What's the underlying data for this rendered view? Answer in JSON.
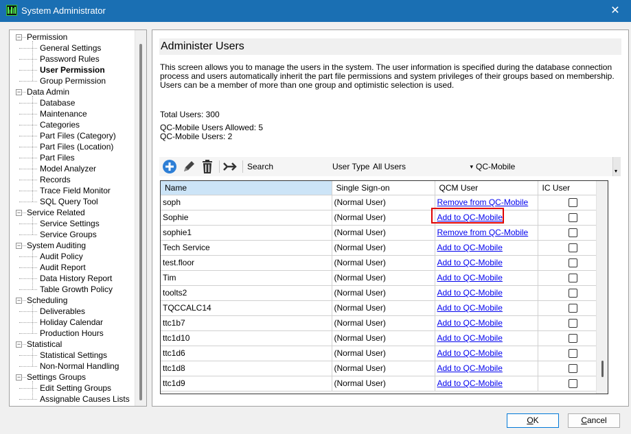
{
  "window": {
    "title": "System Administrator",
    "close_glyph": "✕"
  },
  "tree": {
    "groups": [
      {
        "label": "Permission",
        "children": [
          "General Settings",
          "Password Rules",
          "User Permission",
          "Group Permission"
        ]
      },
      {
        "label": "Data Admin",
        "children": [
          "Database",
          "Maintenance",
          "Categories",
          "Part Files (Category)",
          "Part Files (Location)",
          "Part Files",
          "Model Analyzer",
          "Records",
          "Trace Field Monitor",
          "SQL Query Tool"
        ]
      },
      {
        "label": "Service Related",
        "children": [
          "Service Settings",
          "Service Groups"
        ]
      },
      {
        "label": "System Auditing",
        "children": [
          "Audit Policy",
          "Audit Report",
          "Data History Report",
          "Table Growth Policy"
        ]
      },
      {
        "label": "Scheduling",
        "children": [
          "Deliverables",
          "Holiday Calendar",
          "Production Hours"
        ]
      },
      {
        "label": "Statistical",
        "children": [
          "Statistical Settings",
          "Non-Normal Handling"
        ]
      },
      {
        "label": "Settings Groups",
        "children": [
          "Edit Setting Groups",
          "Assignable Causes Lists"
        ]
      }
    ],
    "selected": "User Permission",
    "expander_glyph": "−"
  },
  "main": {
    "title": "Administer Users",
    "description": "This screen allows you to manage the users in the system. The user information is specified during the database connection process and users automatically inherit the part file permissions and system privileges of their groups based on membership. Users can be a member of more than one group and optimistic selection is used.",
    "total_users": "Total Users: 300",
    "qcm_allowed": "QC-Mobile Users Allowed: 5",
    "qcm_users": "QC-Mobile Users: 2"
  },
  "toolbar": {
    "icons": [
      "add-icon",
      "edit-icon",
      "delete-icon",
      "assign-icon"
    ],
    "search_label": "Search",
    "search_value": "",
    "user_type_label": "User Type",
    "user_type_value": "All Users",
    "caret_glyph": "▾",
    "qcm_label": "QC-Mobile",
    "scroll_glyph": "▾"
  },
  "grid": {
    "columns": [
      "Name",
      "Single Sign-on",
      "QCM User",
      "IC User"
    ],
    "rows": [
      {
        "name": "soph",
        "sso": "(Normal User)",
        "qcm": "Remove from QC-Mobile",
        "ic": false
      },
      {
        "name": "Sophie",
        "sso": "(Normal User)",
        "qcm": "Add to QC-Mobile",
        "ic": false
      },
      {
        "name": "sophie1",
        "sso": "(Normal User)",
        "qcm": "Remove from QC-Mobile",
        "ic": false
      },
      {
        "name": "Tech Service",
        "sso": "(Normal User)",
        "qcm": "Add to QC-Mobile",
        "ic": false
      },
      {
        "name": "test.floor",
        "sso": "(Normal User)",
        "qcm": "Add to QC-Mobile",
        "ic": false
      },
      {
        "name": "Tim",
        "sso": "(Normal User)",
        "qcm": "Add to QC-Mobile",
        "ic": false
      },
      {
        "name": "toolts2",
        "sso": "(Normal User)",
        "qcm": "Add to QC-Mobile",
        "ic": false
      },
      {
        "name": "TQCCALC14",
        "sso": "(Normal User)",
        "qcm": "Add to QC-Mobile",
        "ic": false
      },
      {
        "name": "ttc1b7",
        "sso": "(Normal User)",
        "qcm": "Add to QC-Mobile",
        "ic": false
      },
      {
        "name": "ttc1d10",
        "sso": "(Normal User)",
        "qcm": "Add to QC-Mobile",
        "ic": false
      },
      {
        "name": "ttc1d6",
        "sso": "(Normal User)",
        "qcm": "Add to QC-Mobile",
        "ic": false
      },
      {
        "name": "ttc1d8",
        "sso": "(Normal User)",
        "qcm": "Add to QC-Mobile",
        "ic": false
      },
      {
        "name": "ttc1d9",
        "sso": "(Normal User)",
        "qcm": "Add to QC-Mobile",
        "ic": false
      }
    ]
  },
  "footer": {
    "ok_label": "OK",
    "ok_mnemonic": "O",
    "cancel_label": "Cancel",
    "cancel_mnemonic": "C"
  },
  "colors": {
    "titlebar": "#1a6fb3",
    "link": "#0000ee",
    "highlight": "#e00000",
    "header_active": "#cce4f7"
  }
}
